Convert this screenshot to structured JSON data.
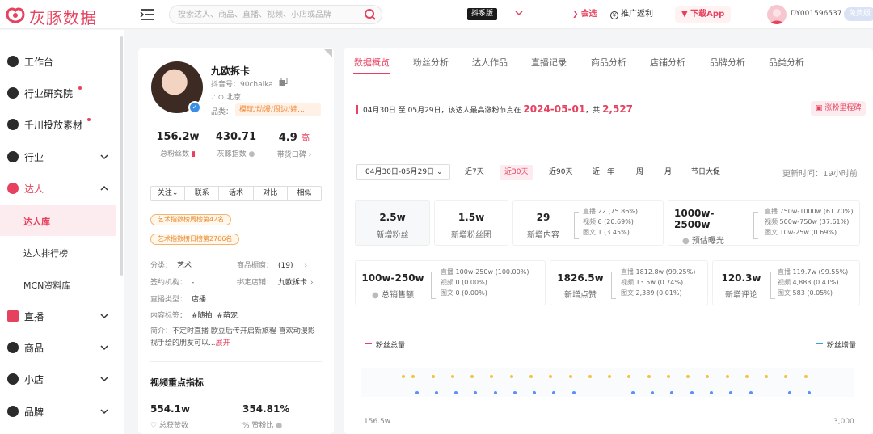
{
  "brand": {
    "name": "灰豚数据",
    "accent": "#e6415e"
  },
  "search": {
    "placeholder": "搜索达人、商品、直播、视频、小店或品牌"
  },
  "platform": "抖系版",
  "top_links": {
    "vip": "会选",
    "rebate": "推广返利",
    "download": "下载App"
  },
  "user": {
    "id": "DY001596537",
    "trial": "免费版"
  },
  "sidebar": {
    "items": [
      {
        "label": "工作台",
        "icon": "home-icon"
      },
      {
        "label": "行业研究院",
        "icon": "research-icon",
        "dot": true
      },
      {
        "label": "千川投放素材",
        "icon": "material-icon",
        "dot": true
      },
      {
        "label": "行业",
        "icon": "industry-icon",
        "chevron": "down"
      },
      {
        "label": "达人",
        "icon": "influencer-icon",
        "chevron": "up"
      },
      {
        "label": "直播",
        "icon": "live-icon",
        "chevron": "down"
      },
      {
        "label": "商品",
        "icon": "product-icon",
        "chevron": "down"
      },
      {
        "label": "小店",
        "icon": "shop-icon",
        "chevron": "down"
      },
      {
        "label": "品牌",
        "icon": "brand-icon",
        "chevron": "down"
      }
    ],
    "sub_items": [
      "达人库",
      "达人排行榜",
      "MCN资料库"
    ]
  },
  "profile": {
    "name": "九欧拆卡",
    "douyin_id": "抖音号：90chaika",
    "location": "北京",
    "category_label": "品类：",
    "category": "模玩/动漫/周边/娃...",
    "stats": [
      {
        "value": "156.2w",
        "label": "总粉丝数"
      },
      {
        "value": "430.71",
        "label": "灰豚指数"
      },
      {
        "value": "4.9",
        "extra": "高",
        "label": "带货口碑"
      }
    ],
    "actions": [
      "关注",
      "联系",
      "话术",
      "对比",
      "相似"
    ],
    "ranks": [
      "艺术指数榜周榜第42名",
      "艺术指数榜日榜第2766名"
    ],
    "info": {
      "category_label": "分类：",
      "category": "艺术",
      "showcase_label": "商品橱窗：",
      "showcase": "(19)",
      "agency_label": "签约机构：",
      "agency": "-",
      "store_label": "绑定店铺：",
      "store": "九欧拆卡",
      "live_type_label": "直播类型：",
      "live_type": "店播",
      "tags_label": "内容标签：",
      "tags": "#随拍  #萌宠",
      "intro_label": "简介：",
      "intro": "不定时直播 欧豆后传开启新旅程 喜欢动漫影视手绘的朋友可以...",
      "expand": "展开"
    },
    "video_section": {
      "title": "视频重点指标",
      "metrics": [
        {
          "value": "554.1w",
          "label": "总获赞数"
        },
        {
          "value": "354.81%",
          "label": "赞粉比"
        }
      ]
    }
  },
  "main": {
    "tabs": [
      "数据概览",
      "粉丝分析",
      "达人作品",
      "直播记录",
      "商品分析",
      "店铺分析",
      "品牌分析",
      "品类分析"
    ],
    "notice": {
      "text": "04月30日 至 05月29日，该达人最高涨粉节点在",
      "date": "2024-05-01",
      "mid": "，共",
      "count": "2,527"
    },
    "milestone": "涨粉里程碑",
    "date_range": "04月30日-05月29日",
    "periods": [
      "近7天",
      "近30天",
      "近90天",
      "近一年",
      "周",
      "月",
      "节日大促"
    ],
    "active_period": "近30天",
    "updated": "更新时间：19小时前",
    "cards_row1": [
      {
        "value": "2.5w",
        "label": "新增粉丝"
      },
      {
        "value": "1.5w",
        "label": "新增粉丝团"
      },
      {
        "value": "29",
        "label": "新增内容",
        "breakdown": [
          {
            "k": "直播",
            "v": "22 (75.86%)"
          },
          {
            "k": "视频",
            "v": "6 (20.69%)"
          },
          {
            "k": "图文",
            "v": "1 (3.45%)"
          }
        ]
      },
      {
        "value": "1000w-2500w",
        "label": "预估曝光",
        "breakdown": [
          {
            "k": "直播",
            "v": "750w-1000w (61.70%)"
          },
          {
            "k": "视频",
            "v": "500w-750w (37.61%)"
          },
          {
            "k": "图文",
            "v": "10w-25w (0.69%)"
          }
        ]
      }
    ],
    "cards_row2": [
      {
        "value": "100w-250w",
        "label": "总销售额",
        "breakdown": [
          {
            "k": "直播",
            "v": "100w-250w (100.00%)"
          },
          {
            "k": "视频",
            "v": "0 (0.00%)"
          },
          {
            "k": "图文",
            "v": "0 (0.00%)"
          }
        ]
      },
      {
        "value": "1826.5w",
        "label": "新增点赞",
        "breakdown": [
          {
            "k": "直播",
            "v": "1812.8w (99.25%)"
          },
          {
            "k": "视频",
            "v": "13.5w (0.74%)"
          },
          {
            "k": "图文",
            "v": "2,389 (0.01%)"
          }
        ]
      },
      {
        "value": "120.3w",
        "label": "新增评论",
        "breakdown": [
          {
            "k": "直播",
            "v": "119.7w (99.55%)"
          },
          {
            "k": "视频",
            "v": "4,883 (0.41%)"
          },
          {
            "k": "图文",
            "v": "583 (0.05%)"
          }
        ]
      }
    ],
    "chart": {
      "legend_left": "粉丝总量",
      "legend_right": "粉丝增量",
      "row_labels": [
        "视频",
        "直播"
      ],
      "y_left_first": "156.5w",
      "y_right_first": "3,000",
      "colors": {
        "video": "#f5c242",
        "live": "#5b8ff9",
        "total": "#e6415e",
        "increment": "#3aa0d8"
      }
    }
  }
}
